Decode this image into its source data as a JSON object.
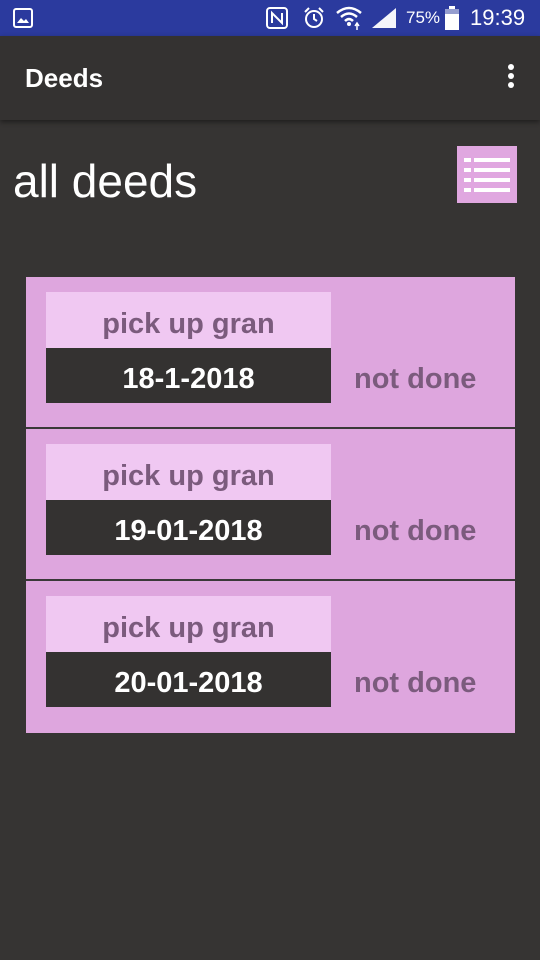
{
  "status_bar": {
    "battery": "75%",
    "time": "19:39",
    "icons": [
      "gallery-icon",
      "nfc-icon",
      "alarm-icon",
      "wifi-icon",
      "signal-icon",
      "battery-icon"
    ]
  },
  "app_bar": {
    "title": "Deeds",
    "menu_icon": "more-vert-icon"
  },
  "page": {
    "heading": "all deeds",
    "list_button_icon": "list-icon"
  },
  "deeds": [
    {
      "name": "pick up gran",
      "date": "18-1-2018",
      "status": "not done"
    },
    {
      "name": "pick up gran",
      "date": "19-01-2018",
      "status": "not done"
    },
    {
      "name": "pick up gran",
      "date": "20-01-2018",
      "status": "not done"
    }
  ],
  "colors": {
    "status_bar": "#2b3a9e",
    "background": "#363433",
    "card": "#dea6de",
    "name_box": "#f0c8f2",
    "muted_text": "#7b5b7d"
  }
}
